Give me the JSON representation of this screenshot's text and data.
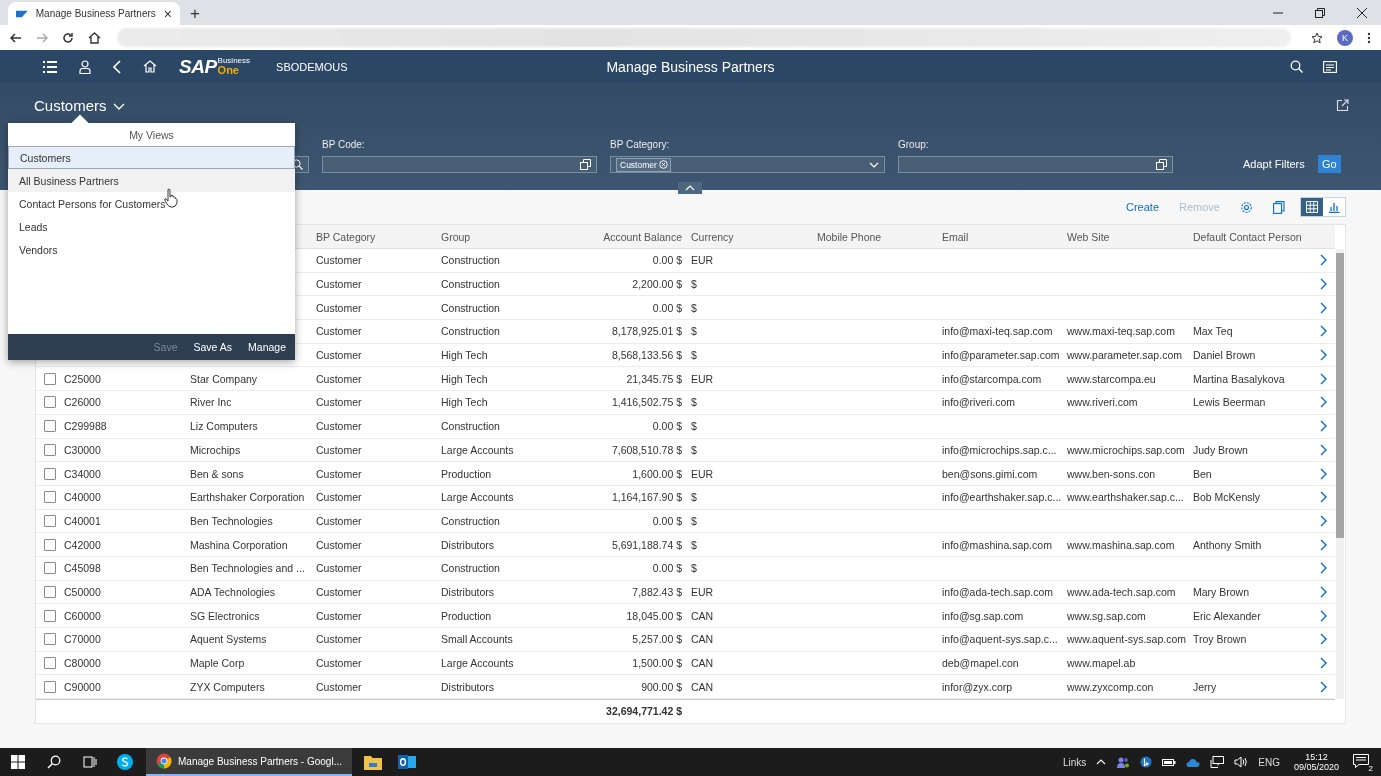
{
  "browser": {
    "tab": {
      "title": "Manage Business Partners",
      "close": "×"
    },
    "new_tab": "+",
    "avatar": "K"
  },
  "shell": {
    "logo": {
      "main": "SAP",
      "line1": "Business",
      "line2": "One"
    },
    "company": "SBODEMOUS",
    "title": "Manage Business Partners"
  },
  "header": {
    "variant": "Customers",
    "filters": [
      {
        "kind": "search"
      },
      {
        "kind": "value_help",
        "label": "BP Code:"
      },
      {
        "kind": "multi_combo",
        "label": "BP Category:",
        "tokens": [
          "Customer"
        ]
      },
      {
        "kind": "value_help",
        "label": "Group:"
      }
    ],
    "adapt_filters": "Adapt Filters",
    "go": "Go"
  },
  "views_popover": {
    "title": "My Views",
    "items": [
      {
        "label": "Customers",
        "selected": true,
        "hovered": false
      },
      {
        "label": "All Business Partners",
        "selected": false,
        "hovered": true
      },
      {
        "label": "Contact Persons for Customers",
        "selected": false,
        "hovered": false
      },
      {
        "label": "Leads",
        "selected": false,
        "hovered": false
      },
      {
        "label": "Vendors",
        "selected": false,
        "hovered": false
      }
    ],
    "actions": [
      {
        "label": "Save",
        "disabled": true
      },
      {
        "label": "Save As",
        "disabled": false
      },
      {
        "label": "Manage",
        "disabled": false
      }
    ]
  },
  "toolbar": {
    "actions": [
      {
        "label": "Create",
        "disabled": false
      },
      {
        "label": "Remove",
        "disabled": true
      }
    ],
    "view_toggle": [
      {
        "kind": "table",
        "selected": true
      },
      {
        "kind": "chart",
        "selected": false
      }
    ]
  },
  "table": {
    "columns": [
      "BP Category",
      "Group",
      "Account Balance",
      "Currency",
      "Mobile Phone",
      "Email",
      "Web Site",
      "Default Contact Person"
    ],
    "rows": [
      {
        "category": "Customer",
        "group": "Construction",
        "balance": "0.00 $",
        "currency": "EUR"
      },
      {
        "category": "Customer",
        "group": "Construction",
        "balance": "2,200.00 $",
        "currency": "$"
      },
      {
        "category": "Customer",
        "group": "Construction",
        "balance": "0.00 $",
        "currency": "$"
      },
      {
        "category": "Customer",
        "group": "Construction",
        "balance": "8,178,925.01 $",
        "currency": "$",
        "email": "info@maxi-teq.sap.com",
        "website": "www.maxi-teq.sap.com",
        "contact": "Max Teq"
      },
      {
        "category": "Customer",
        "group": "High Tech",
        "balance": "8,568,133.56 $",
        "currency": "$",
        "email": "info@parameter.sap.com",
        "website": "www.parameter.sap.com",
        "contact": "Daniel Brown"
      },
      {
        "checked": false,
        "code": "C25000",
        "name": "Star Company",
        "category": "Customer",
        "group": "High Tech",
        "balance": "21,345.75 $",
        "currency": "EUR",
        "email": "info@starcompa.com",
        "website": "www.starcompa.eu",
        "contact": "Martina Basalykova"
      },
      {
        "checked": false,
        "code": "C26000",
        "name": "River Inc",
        "category": "Customer",
        "group": "High Tech",
        "balance": "1,416,502.75 $",
        "currency": "$",
        "email": "info@riveri.com",
        "website": "www.riveri.com",
        "contact": "Lewis Beerman"
      },
      {
        "checked": false,
        "code": "C299988",
        "name": "Liz Computers",
        "category": "Customer",
        "group": "Construction",
        "balance": "0.00 $",
        "currency": "$"
      },
      {
        "checked": false,
        "code": "C30000",
        "name": "Microchips",
        "category": "Customer",
        "group": "Large Accounts",
        "balance": "7,608,510.78 $",
        "currency": "$",
        "email": "info@microchips.sap.c...",
        "website": "www.microchips.sap.com",
        "contact": "Judy Brown"
      },
      {
        "checked": false,
        "code": "C34000",
        "name": "Ben & sons",
        "category": "Customer",
        "group": "Production",
        "balance": "1,600.00 $",
        "currency": "EUR",
        "email": "ben@sons.gimi.com",
        "website": "www.ben-sons.con",
        "contact": "Ben"
      },
      {
        "checked": false,
        "code": "C40000",
        "name": "Earthshaker Corporation",
        "category": "Customer",
        "group": "Large Accounts",
        "balance": "1,164,167.90 $",
        "currency": "$",
        "email": "info@earthshaker.sap.c...",
        "website": "www.earthshaker.sap.c...",
        "contact": "Bob McKensly"
      },
      {
        "checked": false,
        "code": "C40001",
        "name": "Ben Technologies",
        "category": "Customer",
        "group": "Construction",
        "balance": "0.00 $",
        "currency": "$"
      },
      {
        "checked": false,
        "code": "C42000",
        "name": "Mashina Corporation",
        "category": "Customer",
        "group": "Distributors",
        "balance": "5,691,188.74 $",
        "currency": "$",
        "email": "info@mashina.sap.com",
        "website": "www.mashina.sap.com",
        "contact": "Anthony Smith"
      },
      {
        "checked": false,
        "code": "C45098",
        "name": "Ben Technologies and ...",
        "category": "Customer",
        "group": "Construction",
        "balance": "0.00 $",
        "currency": "$"
      },
      {
        "checked": false,
        "code": "C50000",
        "name": "ADA Technologies",
        "category": "Customer",
        "group": "Distributors",
        "balance": "7,882.43 $",
        "currency": "EUR",
        "email": "info@ada-tech.sap.com",
        "website": "www.ada-tech.sap.com",
        "contact": "Mary Brown"
      },
      {
        "checked": false,
        "code": "C60000",
        "name": "SG Electronics",
        "category": "Customer",
        "group": "Production",
        "balance": "18,045.00 $",
        "currency": "CAN",
        "email": "info@sg.sap.com",
        "website": "www.sg.sap.com",
        "contact": "Eric Alexander"
      },
      {
        "checked": false,
        "code": "C70000",
        "name": "Aquent Systems",
        "category": "Customer",
        "group": "Small Accounts",
        "balance": "5,257.00 $",
        "currency": "CAN",
        "email": "info@aquent-sys.sap.c...",
        "website": "www.aquent-sys.sap.com",
        "contact": "Troy Brown"
      },
      {
        "checked": false,
        "code": "C80000",
        "name": "Maple Corp",
        "category": "Customer",
        "group": "Large Accounts",
        "balance": "1,500.00 $",
        "currency": "CAN",
        "email": "deb@mapel.con",
        "website": "www.mapel.ab"
      },
      {
        "checked": false,
        "code": "C90000",
        "name": "ZYX Computers",
        "category": "Customer",
        "group": "Distributors",
        "balance": "900.00 $",
        "currency": "CAN",
        "email": "infor@zyx.corp",
        "website": "www.zyxcomp.con",
        "contact": "Jerry"
      }
    ],
    "total": "32,694,771.42 $"
  },
  "taskbar": {
    "apps": [
      {
        "kind": "skype",
        "active": false
      },
      {
        "kind": "chrome",
        "label": "Manage Business Partners - Googl...",
        "active": true
      },
      {
        "kind": "explorer",
        "active": false
      },
      {
        "kind": "outlook",
        "active": false
      }
    ],
    "tray": {
      "links": "Links",
      "language": "ENG",
      "time": "15:12",
      "date": "09/05/2020",
      "notifications": "2"
    }
  }
}
